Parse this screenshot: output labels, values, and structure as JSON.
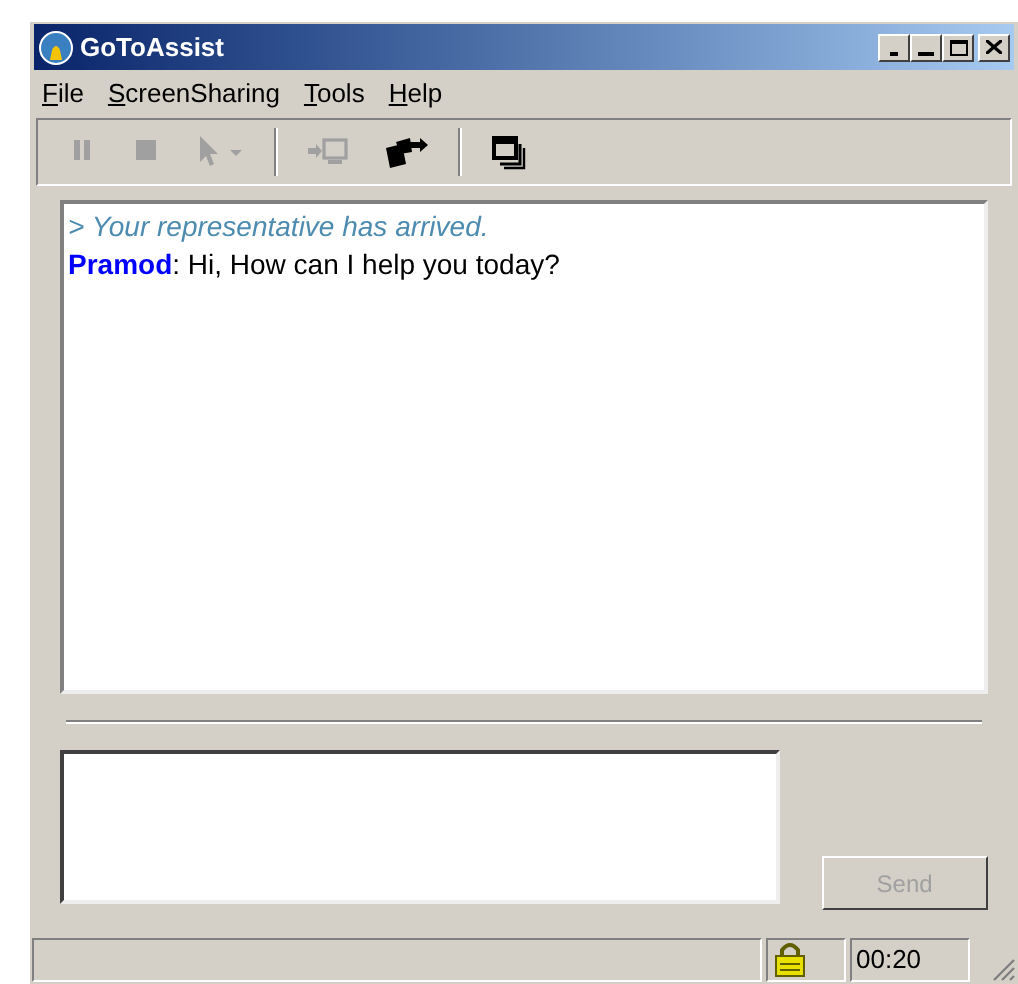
{
  "window": {
    "title": "GoToAssist"
  },
  "menu": [
    {
      "label": "File"
    },
    {
      "label": "ScreenSharing"
    },
    {
      "label": "Tools"
    },
    {
      "label": "Help"
    }
  ],
  "toolbar": [
    {
      "kind": "pause",
      "disabled": true
    },
    {
      "kind": "stop",
      "disabled": true
    },
    {
      "kind": "pointer",
      "disabled": true
    },
    {
      "kind": "separator"
    },
    {
      "kind": "share",
      "disabled": true
    },
    {
      "kind": "transfer",
      "disabled": false
    },
    {
      "kind": "separator"
    },
    {
      "kind": "windows",
      "disabled": false
    }
  ],
  "chat": [
    {
      "kind": "system",
      "text": "> Your representative has arrived."
    },
    {
      "kind": "message",
      "sender": "Pramod",
      "text": ": Hi, How can I help you today?"
    }
  ],
  "send_button": {
    "label": "Send",
    "disabled": true
  },
  "status_bar": {
    "secure": true,
    "time": "00:20"
  }
}
